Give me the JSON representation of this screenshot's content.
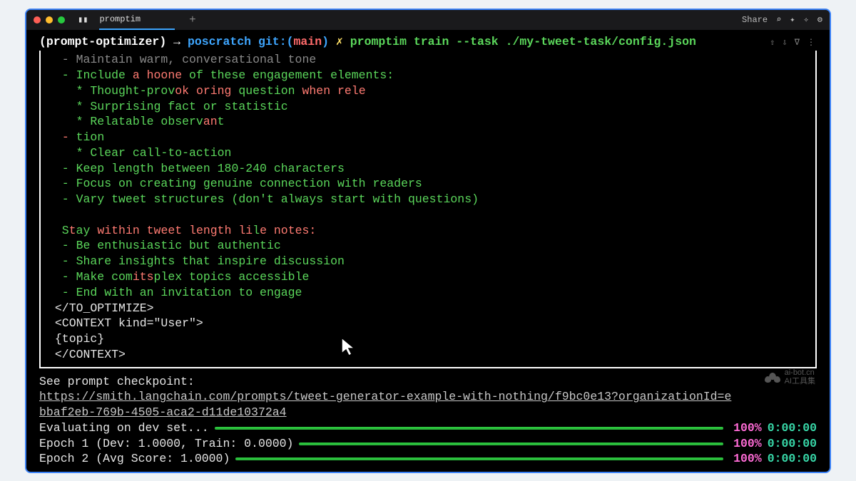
{
  "titlebar": {
    "tab_label": "promptim",
    "share_label": "Share"
  },
  "command": {
    "env": "(prompt-optimizer)",
    "arrow": "→",
    "dir": "poscratch",
    "git_label": "git:(",
    "branch": "main",
    "git_close": ")",
    "dirty": "✗",
    "exec": "promptim train --task ./my-tweet-task/config.json"
  },
  "body": {
    "l0": "  - Maintain warm, conversational tone",
    "l1a": "  - Include ",
    "l1b": "a hoone",
    "l1c": " of these engagement elements:",
    "l2a": "    * Thought-prov",
    "l2b": "ok oring",
    "l2c": " question ",
    "l2d": "when rele",
    "l3": "    * Surprising fact or statistic",
    "l4a": "    * Relatable observ",
    "l4b": "an",
    "l4c": "t",
    "l5a": "  ",
    "l5b": "-",
    "l5c": " tion",
    "l6": "    * Clear call-to-action",
    "l7": "  - Keep length between 180-240 characters",
    "l8": "  - Focus on creating genuine connection with readers",
    "l9": "  - Vary tweet structures (don't always start with questions)",
    "blank": " ",
    "s1a": "  S",
    "s1b": "t",
    "s1c": "ay ",
    "s1d": "within tweet length li",
    "s1e": "l",
    "s1f": "e notes:",
    "s2": "  - Be enthusiastic but authentic",
    "s3": "  - Share insights that inspire discussion",
    "s4a": "  - Make com",
    "s4b": "its",
    "s4c": "plex topics accessible",
    "s5": "  - End with an invitation to engage",
    "tag1": " </TO_OPTIMIZE>",
    "tag2": " <CONTEXT kind=\"User\">",
    "tag3": " {topic}",
    "tag4": " </CONTEXT>"
  },
  "footer": {
    "checkpoint_label": "See prompt checkpoint:",
    "url_line1": "https://smith.langchain.com/prompts/tweet-generator-example-with-nothing/f9bc0e13?organizationId=e",
    "url_line2": "bbaf2eb-769b-4505-aca2-d11de10372a4",
    "eval_label": "Evaluating on dev set...",
    "epoch1_label": "Epoch 1 (Dev: 1.0000, Train: 0.0000)",
    "epoch2_label": "Epoch 2 (Avg Score: 1.0000)",
    "pct": "100%",
    "time": "0:00:00"
  },
  "watermark": {
    "line1": "ai-bot.cn",
    "line2": "AI工具集"
  }
}
